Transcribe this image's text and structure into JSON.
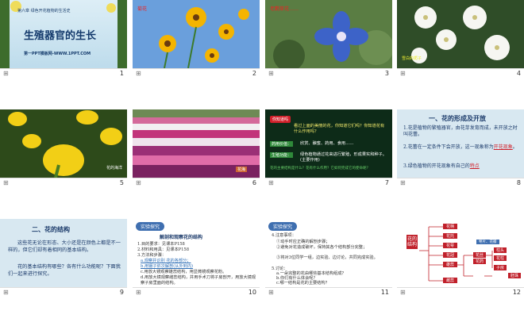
{
  "slides": [
    {
      "num": "1",
      "sup": "第六章  绿色开花植物的生活史",
      "title": "生殖器官的生长",
      "footer": "第一PPT模板网-WWW.1PPT.COM"
    },
    {
      "num": "2",
      "tag": "菊花"
    },
    {
      "num": "3",
      "tag": "老鹳草花……"
    },
    {
      "num": "4",
      "tag": "雪白的栀子"
    },
    {
      "num": "5",
      "tag": "花的海洋"
    },
    {
      "num": "6",
      "tag": "花海"
    },
    {
      "num": "7",
      "intro": "你知道吗",
      "q": "看过上面的美丽的花，你知道它们吗？你知道花有什么作用吗？",
      "r1k": "药用价值：",
      "r1v": "欣赏、酿蜜、药用、食用……",
      "r2k": "生殖功能：",
      "r2v": "绿色植物通过花来进行繁殖，形成果实和种子。(主要作用)",
      "note": "花的主要结构是什么？花有什么作用？它如何完成它的使命呢？"
    },
    {
      "num": "8",
      "title": "一、花的形成及开放",
      "p1": "1.花是植物的繁殖器官，由花芽发育而成，未开放之时叫花蕾。",
      "p2a": "2.花蕾在一定条件下会开放，这一现象称为",
      "p2k": "开花现象",
      "p2b": "。",
      "p3a": "3.绿色植物的开花现象有自己的",
      "p3k": "特点"
    },
    {
      "num": "9",
      "title": "二、花的结构",
      "p1": "这些花无论在形态、大小还是在颜色上都是不一样的，但它们却有着相同的基本结构。",
      "p2": "花的基本结构有哪些？各有什么功能呢？下面我们一起来进行探究。"
    },
    {
      "num": "10",
      "tab": "实验探究",
      "title": "解剖和观察花的结构",
      "items": [
        "1.目的要求：见课本P158",
        "2.材料和用具：见课本P158",
        "3.方法和步骤："
      ],
      "steps": [
        "a.观察并识别 花的各部分；",
        "b.用镊子依次解剖(从外到内)",
        "c.用放大镜观察雄蕊结构，用显微镜观察花粉。",
        "d.用放大镜观察雌蕊结构，并用手术刀将子房剖开，用放大镜观察子房里面的结构。"
      ]
    },
    {
      "num": "11",
      "tab": "实验探究",
      "lines": [
        "4.注意事项：",
        "①动手时应正确的解剖步骤；",
        "②避免对花造成破坏，保持其各个结构部分完整；",
        "③将对3位同学一组，边实验、边讨论，共同完成实验。",
        "5.讨论：",
        "a.一朵完整的花由哪些基本结构组成？",
        "b.你们有什么体会呢？",
        "c.哪一结构是花的主要结构？"
      ]
    },
    {
      "num": "12",
      "root": "花的结构",
      "boxes": [
        "花柄",
        "花托",
        "花萼",
        "花冠",
        "雄蕊",
        "雌蕊"
      ],
      "mid": [
        "花丝",
        "花药",
        "柱头",
        "花柱",
        "子房",
        "胚珠"
      ],
      "extra": [
        "萼片、花瓣"
      ]
    }
  ],
  "colors": {
    "green1": "#2f7d3a",
    "green2": "#3e9a4b",
    "lightblue": "#d9e9f2",
    "bluegray": "#c5dbe8",
    "red": "#c0202a"
  }
}
